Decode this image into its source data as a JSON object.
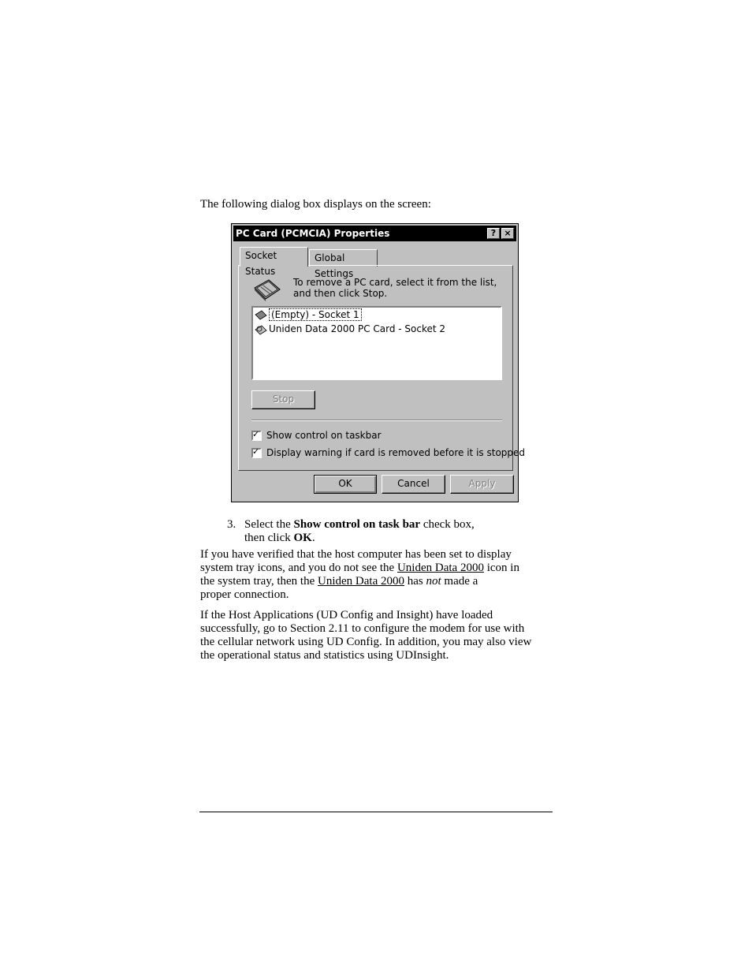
{
  "intro": "The following dialog box displays on the screen:",
  "dialog": {
    "title": "PC Card (PCMCIA) Properties",
    "help_button": "?",
    "close_button": "×",
    "tabs": [
      "Socket Status",
      "Global Settings"
    ],
    "info_text": "To remove a PC card, select it from the list, and then click Stop.",
    "list_items": [
      "(Empty) - Socket 1",
      "Uniden Data 2000 PC Card - Socket 2"
    ],
    "stop_button": "Stop",
    "checkboxes": [
      {
        "label": "Show control on taskbar",
        "checked": true
      },
      {
        "label": "Display warning if card is removed before it is stopped",
        "checked": true
      }
    ],
    "ok_button": "OK",
    "cancel_button": "Cancel",
    "apply_button": "Apply"
  },
  "step": {
    "number": "3.",
    "pre": "Select the ",
    "bold1": "Show control on task bar",
    "mid": " check box,",
    "line2_pre": "then click ",
    "bold2": "OK",
    "line2_post": "."
  },
  "para1": {
    "l1": "If you have verified that the host computer has been set to display",
    "l2_pre": "system tray icons, and you do not see the ",
    "l2_link": "Uniden Data 2000",
    "l2_post": " icon in",
    "l3_pre": "the system tray, then the ",
    "l3_link": "Uniden Data 2000",
    "l3_mid": " has ",
    "l3_em": "not",
    "l3_post": " made a",
    "l4": "proper connection."
  },
  "para2": {
    "l1": "If the Host Applications (UD Config and Insight) have loaded",
    "l2": "successfully, go to Section 2.11 to configure the modem for use with",
    "l3": "the cellular network using UD Config. In addition, you may also view",
    "l4": "the operational status and statistics using UDInsight."
  }
}
